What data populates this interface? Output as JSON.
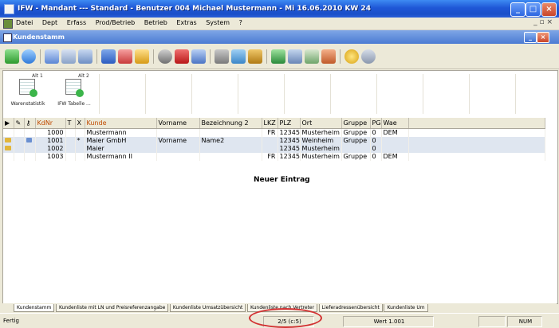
{
  "window": {
    "title": "IFW - Mandant  ---  Standard - Benutzer 004 Michael Mustermann  - Mi 16.06.2010 KW 24",
    "min_label": "_",
    "max_label": "□",
    "close_label": "×"
  },
  "menu": {
    "items": [
      "Datei",
      "Dept",
      "Erfass",
      "Prod/Betrieb",
      "Betrieb",
      "Extras",
      "System",
      "?"
    ],
    "mdi_controls": "_ ▫ ×"
  },
  "inner_window": {
    "title": "Kundenstamm"
  },
  "reports": [
    {
      "tag": "Alt 1",
      "label": "Warenstatistik"
    },
    {
      "tag": "Alt 2",
      "label": "IFW Tabelle ..."
    }
  ],
  "grid": {
    "columns": [
      "",
      "",
      "",
      "KdNr",
      "T",
      "X",
      "Kunde",
      "Vorname",
      "Bezeichnung 2",
      "LKZ",
      "PLZ",
      "Ort",
      "Gruppe",
      "PG",
      "Wae"
    ],
    "rows": [
      {
        "KdNr": "1000",
        "T": "",
        "X": "",
        "Kunde": "Mustermann",
        "Vorname": "",
        "Bez2": "",
        "LKZ": "FR",
        "PLZ": "12345",
        "Ort": "Musterheim",
        "Gruppe": "Gruppe",
        "PG": "0",
        "Wae": "DEM"
      },
      {
        "KdNr": "1001",
        "T": "",
        "X": "*",
        "Kunde": "Maier GmbH",
        "Vorname": "Vorname",
        "Bez2": "Name2",
        "LKZ": "",
        "PLZ": "12345",
        "Ort": "Weinheim",
        "Gruppe": "Gruppe",
        "PG": "0",
        "Wae": ""
      },
      {
        "KdNr": "1002",
        "T": "",
        "X": "",
        "Kunde": "Maier",
        "Vorname": "",
        "Bez2": "",
        "LKZ": "",
        "PLZ": "12345",
        "Ort": "Musterheim",
        "Gruppe": "",
        "PG": "0",
        "Wae": ""
      },
      {
        "KdNr": "1003",
        "T": "",
        "X": "",
        "Kunde": "Mustermann II",
        "Vorname": "",
        "Bez2": "",
        "LKZ": "FR",
        "PLZ": "12345",
        "Ort": "Musterheim",
        "Gruppe": "Gruppe",
        "PG": "0",
        "Wae": "DEM"
      }
    ],
    "new_entry": "Neuer Eintrag"
  },
  "sheet_tabs": [
    "Kundenstamm",
    "Kundenliste mit LN und Preisreferenzangabe",
    "Kundenliste Umsatzübersicht",
    "Kundenliste nach Vertreter",
    "Lieferadressenübersicht",
    "Kundenliste Um"
  ],
  "status": {
    "left": "Fertig",
    "record": "2/5 (c:5)",
    "value": "Wert 1.001",
    "num": "NUM"
  },
  "colors": {
    "title_bar": "#1f57d6",
    "highlight_column": "#c04a00",
    "annotation_ellipse": "#d23232",
    "alt_row": "#dfe6f0"
  },
  "icons": {
    "toolbar": [
      "back-arrow-icon",
      "refresh-icon",
      "doc-blue-icon",
      "doc-grid-icon",
      "table-icon",
      "book-icon",
      "list-icon",
      "key-icon",
      "binoculars-icon",
      "stop-icon",
      "card-icon",
      "phone-icon",
      "users-icon",
      "book-stack-icon",
      "excel-icon",
      "print-icon",
      "document-edit-icon",
      "export-icon",
      "coin-icon",
      "help-icon"
    ]
  }
}
